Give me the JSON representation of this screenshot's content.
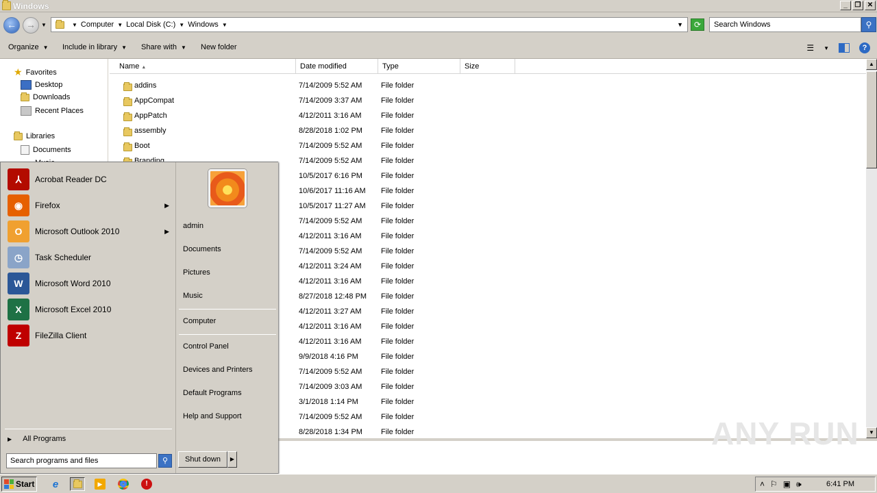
{
  "window": {
    "title": "Windows"
  },
  "address": {
    "crumbs": [
      "Computer",
      "Local Disk (C:)",
      "Windows"
    ],
    "search_placeholder": "Search Windows"
  },
  "toolbar": {
    "organize": "Organize",
    "include": "Include in library",
    "share": "Share with",
    "new_folder": "New folder"
  },
  "navpane": {
    "favorites": "Favorites",
    "desktop": "Desktop",
    "downloads": "Downloads",
    "recent": "Recent Places",
    "libraries": "Libraries",
    "documents": "Documents",
    "music": "Music"
  },
  "columns": {
    "name": "Name",
    "date": "Date modified",
    "type": "Type",
    "size": "Size"
  },
  "files": [
    {
      "name": "addins",
      "date": "7/14/2009 5:52 AM",
      "type": "File folder"
    },
    {
      "name": "AppCompat",
      "date": "7/14/2009 3:37 AM",
      "type": "File folder"
    },
    {
      "name": "AppPatch",
      "date": "4/12/2011 3:16 AM",
      "type": "File folder"
    },
    {
      "name": "assembly",
      "date": "8/28/2018 1:02 PM",
      "type": "File folder"
    },
    {
      "name": "Boot",
      "date": "7/14/2009 5:52 AM",
      "type": "File folder"
    },
    {
      "name": "Branding",
      "date": "7/14/2009 5:52 AM",
      "type": "File folder"
    },
    {
      "name": "",
      "date": "10/5/2017 6:16 PM",
      "type": "File folder"
    },
    {
      "name": "",
      "date": "10/6/2017 11:16 AM",
      "type": "File folder"
    },
    {
      "name": "",
      "date": "10/5/2017 11:27 AM",
      "type": "File folder"
    },
    {
      "name": "",
      "date": "7/14/2009 5:52 AM",
      "type": "File folder"
    },
    {
      "name": "",
      "date": "4/12/2011 3:16 AM",
      "type": "File folder"
    },
    {
      "name": "",
      "date": "7/14/2009 5:52 AM",
      "type": "File folder"
    },
    {
      "name": "",
      "date": "4/12/2011 3:24 AM",
      "type": "File folder"
    },
    {
      "name": "",
      "date": "4/12/2011 3:16 AM",
      "type": "File folder"
    },
    {
      "name": "",
      "date": "8/27/2018 12:48 PM",
      "type": "File folder"
    },
    {
      "name": "",
      "date": "4/12/2011 3:27 AM",
      "type": "File folder"
    },
    {
      "name": "",
      "date": "4/12/2011 3:16 AM",
      "type": "File folder"
    },
    {
      "name": "",
      "date": "4/12/2011 3:16 AM",
      "type": "File folder"
    },
    {
      "name": "",
      "date": "9/9/2018 4:16 PM",
      "type": "File folder"
    },
    {
      "name": "",
      "date": "7/14/2009 5:52 AM",
      "type": "File folder"
    },
    {
      "name": "",
      "date": "7/14/2009 3:03 AM",
      "type": "File folder"
    },
    {
      "name": "",
      "date": "3/1/2018 1:14 PM",
      "type": "File folder"
    },
    {
      "name": "",
      "date": "7/14/2009 5:52 AM",
      "type": "File folder"
    },
    {
      "name": "",
      "date": "8/28/2018 1:34 PM",
      "type": "File folder"
    }
  ],
  "startmenu": {
    "programs": [
      {
        "label": "Acrobat Reader DC",
        "icon": "acrobat-icon",
        "color": "#b30b00"
      },
      {
        "label": "Firefox",
        "icon": "firefox-icon",
        "color": "#e66000"
      },
      {
        "label": "Microsoft Outlook 2010",
        "icon": "outlook-icon",
        "color": "#f0a030"
      },
      {
        "label": "Task Scheduler",
        "icon": "clock-icon",
        "color": "#8aa4c8"
      },
      {
        "label": "Microsoft Word 2010",
        "icon": "word-icon",
        "color": "#2b5797"
      },
      {
        "label": "Microsoft Excel 2010",
        "icon": "excel-icon",
        "color": "#1e7145"
      },
      {
        "label": "FileZilla Client",
        "icon": "filezilla-icon",
        "color": "#bf0000"
      }
    ],
    "all_programs": "All Programs",
    "search_placeholder": "Search programs and files",
    "right": {
      "user": "admin",
      "documents": "Documents",
      "pictures": "Pictures",
      "music": "Music",
      "computer": "Computer",
      "control_panel": "Control Panel",
      "devices": "Devices and Printers",
      "default_programs": "Default Programs",
      "help": "Help and Support"
    },
    "shutdown": "Shut down"
  },
  "taskbar": {
    "start": "Start",
    "clock": "6:41 PM"
  },
  "watermark": "ANY RUN"
}
